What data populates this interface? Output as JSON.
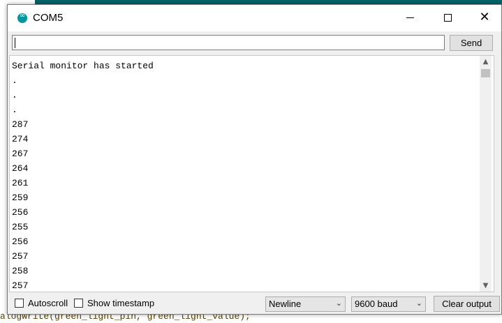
{
  "window": {
    "title": "COM5"
  },
  "input": {
    "value": "",
    "send_label": "Send"
  },
  "output": {
    "lines": [
      "Serial monitor has started",
      ".",
      ".",
      ".",
      "287",
      "274",
      "267",
      "264",
      "261",
      "259",
      "256",
      "255",
      "256",
      "257",
      "258",
      "257"
    ]
  },
  "bottom": {
    "autoscroll_label": "Autoscroll",
    "autoscroll_checked": false,
    "timestamp_label": "Show timestamp",
    "timestamp_checked": false,
    "line_ending": "Newline",
    "baud": "9600 baud",
    "clear_label": "Clear output"
  },
  "background_code": {
    "bottom_line": "alogWrite(green_light_pin, green_light_value);"
  },
  "colors": {
    "ide_teal": "#006468",
    "icon_teal": "#00979d"
  }
}
